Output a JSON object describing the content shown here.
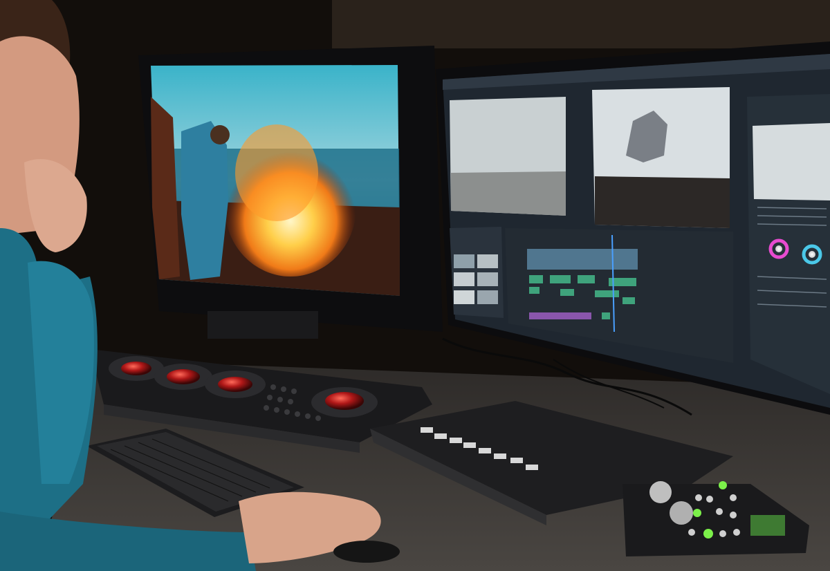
{
  "scene": {
    "subject": "",
    "palette": {
      "room": "#1a1410",
      "desk": "#3a3633",
      "sweater": "#1d6f86",
      "skin": "#d9a58a",
      "fire": "#ffb43a",
      "sky": "#3ab3c9",
      "ui_panel": "#2b3540",
      "ui_bg": "#1f2730",
      "clip_green": "#3fa37c",
      "trackball": "#b01818",
      "led_green": "#7cf04a"
    }
  },
  "left_monitor": {
    "content": ""
  },
  "right_monitor": {
    "app": "",
    "panels": [
      "source-monitor",
      "program-monitor",
      "lumetri-panel",
      "project-bin",
      "timeline"
    ]
  },
  "devices": [
    "color-grading-panel",
    "keyboard",
    "audio-mixer",
    "control-surface",
    "mouse"
  ]
}
